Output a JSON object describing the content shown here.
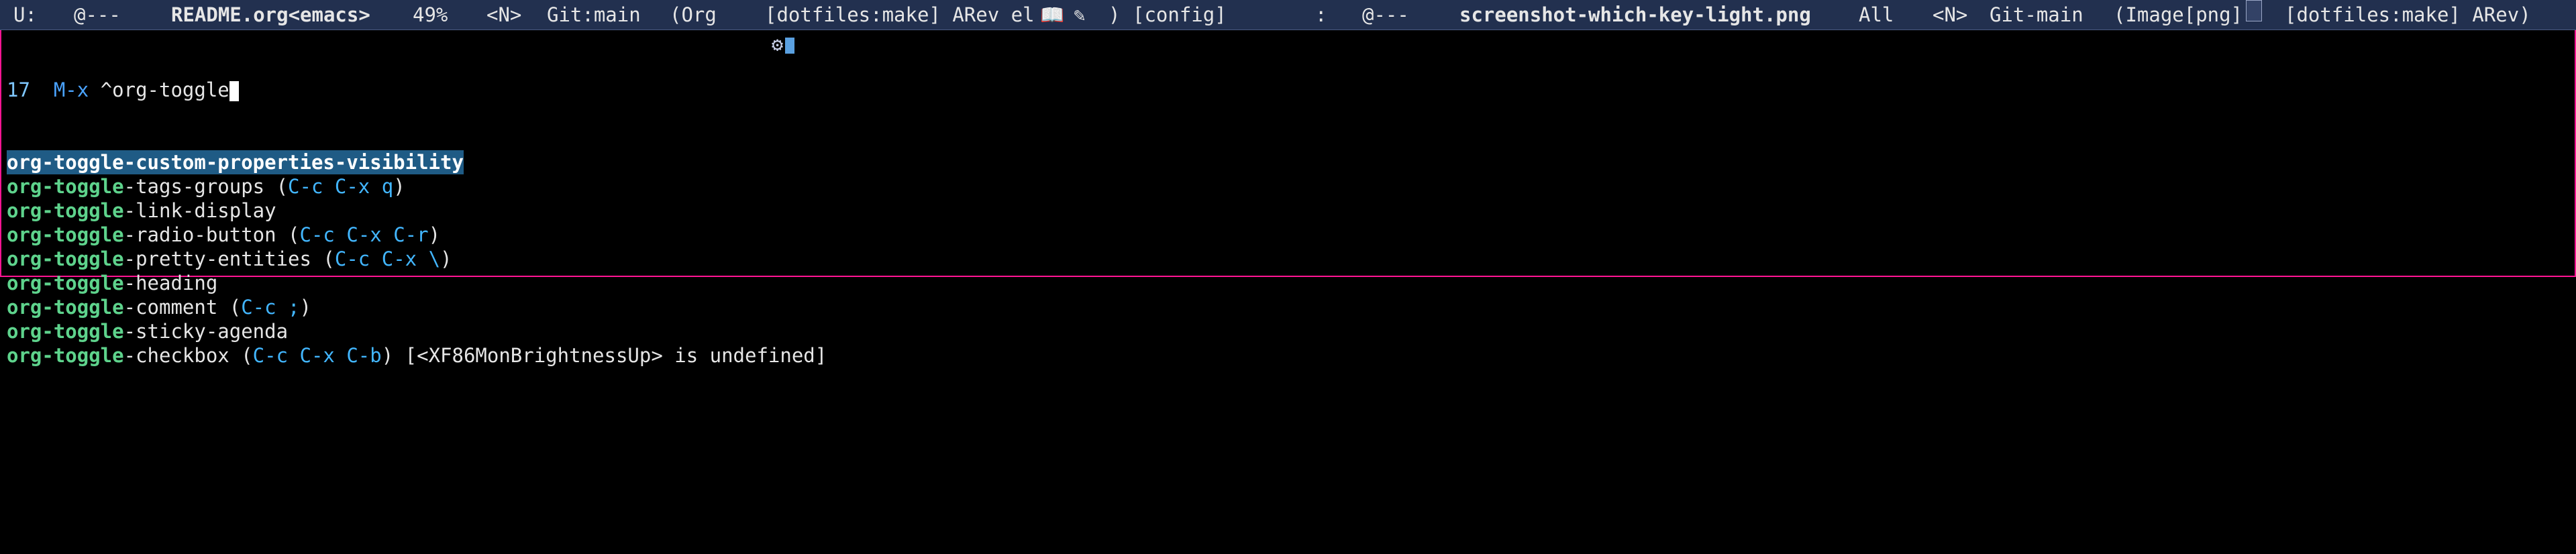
{
  "modeline": {
    "left": {
      "state": "U:",
      "flags": "@---",
      "buffer": "README.org<emacs>",
      "percent": "49%",
      "evil": "<N>",
      "vc": "Git:main",
      "mode": "(Org",
      "segment": "[dotfiles:make] ARev el",
      "close": ")",
      "workspace": "[config]"
    },
    "right": {
      "sep": ":",
      "flags": "@---",
      "buffer": "screenshot-which-key-light.png",
      "position": "All",
      "evil": "<N>",
      "vc": "Git-main",
      "mode": "(Image[png]",
      "segment": "[dotfiles:make] ARev)"
    }
  },
  "minibuffer": {
    "count": "17",
    "prompt": "M-x",
    "input": "^org-toggle",
    "candidates": [
      {
        "match": "org-toggle",
        "rest": "-custom-properties-visibility",
        "key": "",
        "selected": true
      },
      {
        "match": "org-toggle",
        "rest": "-tags-groups",
        "key": "C-c C-x q",
        "selected": false
      },
      {
        "match": "org-toggle",
        "rest": "-link-display",
        "key": "",
        "selected": false
      },
      {
        "match": "org-toggle",
        "rest": "-radio-button",
        "key": "C-c C-x C-r",
        "selected": false
      },
      {
        "match": "org-toggle",
        "rest": "-pretty-entities",
        "key": "C-c C-x \\",
        "selected": false
      },
      {
        "match": "org-toggle",
        "rest": "-heading",
        "key": "",
        "selected": false
      },
      {
        "match": "org-toggle",
        "rest": "-comment",
        "key": "C-c ;",
        "selected": false
      },
      {
        "match": "org-toggle",
        "rest": "-sticky-agenda",
        "key": "",
        "selected": false
      },
      {
        "match": "org-toggle",
        "rest": "-checkbox",
        "key": "C-c C-x C-b",
        "selected": false
      }
    ],
    "message": "[<XF86MonBrightnessUp> is undefined]"
  }
}
